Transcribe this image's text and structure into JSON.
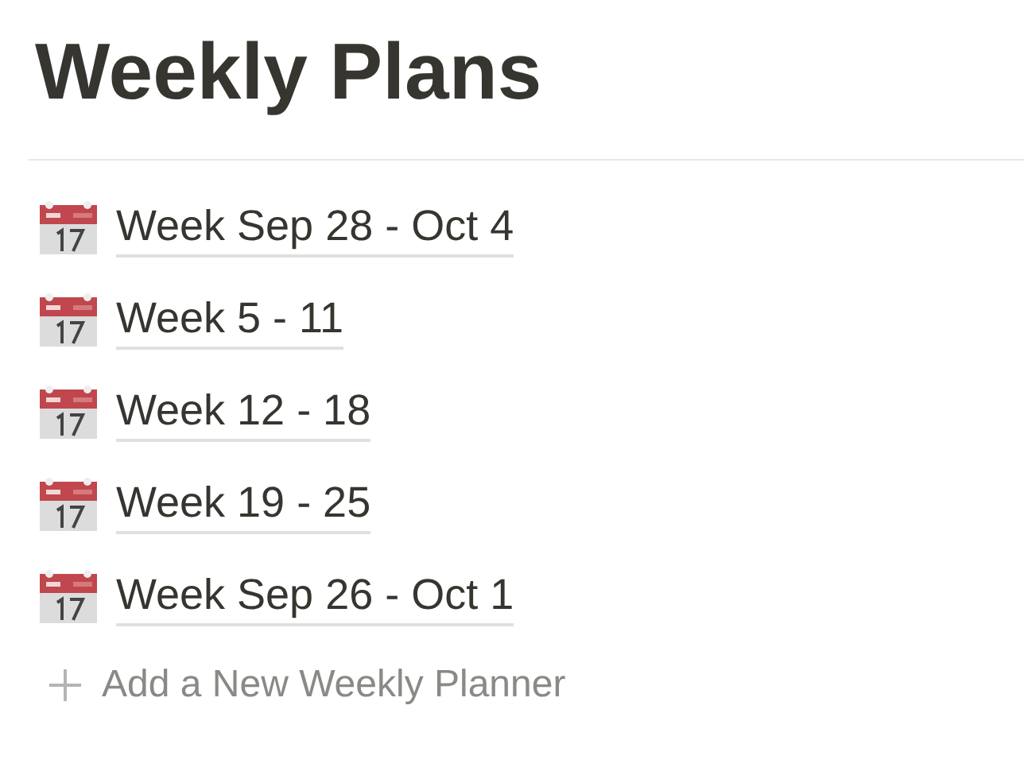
{
  "title": "Weekly Plans",
  "pages": [
    {
      "label": "Week Sep 28 - Oct 4"
    },
    {
      "label": "Week 5 - 11"
    },
    {
      "label": "Week 12 - 18"
    },
    {
      "label": "Week 19 - 25"
    },
    {
      "label": "Week Sep 26 - Oct 1"
    }
  ],
  "add_button": {
    "label": "Add a New Weekly Planner"
  }
}
